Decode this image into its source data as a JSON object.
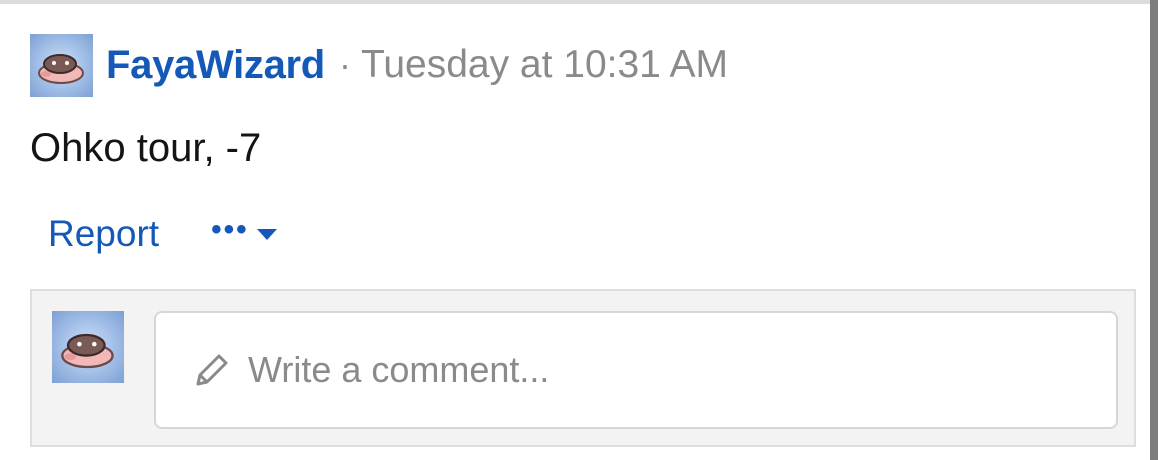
{
  "post": {
    "author": "FayaWizard",
    "separator": "·",
    "timestamp": "Tuesday at 10:31 AM",
    "body": "Ohko tour, -7",
    "avatar_icon": "pokemon-avatar-icon"
  },
  "actions": {
    "report_label": "Report",
    "more_label": "•••",
    "more_icon": "caret-down-icon"
  },
  "comment": {
    "placeholder": "Write a comment...",
    "input_icon": "pencil-icon"
  },
  "colors": {
    "link": "#1459b8",
    "muted": "#8a8a8a",
    "body_text": "#141414",
    "comment_bg": "#f3f3f3",
    "scroll_bar": "#7d7d7d"
  }
}
